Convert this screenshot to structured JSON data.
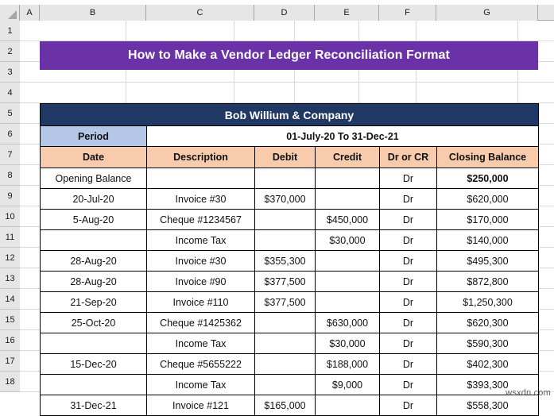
{
  "spreadsheet": {
    "column_headers": [
      "A",
      "B",
      "C",
      "D",
      "E",
      "F",
      "G"
    ],
    "row_numbers": [
      "1",
      "2",
      "3",
      "4",
      "5",
      "6",
      "7",
      "8",
      "9",
      "10",
      "11",
      "12",
      "13",
      "14",
      "15",
      "16",
      "17",
      "18"
    ]
  },
  "colors": {
    "banner_purple": "#6B32A8",
    "company_navy": "#1F3864",
    "period_blue": "#B4C7E7",
    "header_peach": "#F8CBAD",
    "grid_gray": "#D9D9D9",
    "header_strip": "#E6E6E6"
  },
  "banner": {
    "title": "How to Make a Vendor Ledger Reconciliation Format"
  },
  "ledger": {
    "company_name": "Bob Willium & Company",
    "period_label": "Period",
    "period_value": "01-July-20 To 31-Dec-21",
    "columns": [
      "Date",
      "Description",
      "Debit",
      "Credit",
      "Dr or CR",
      "Closing Balance"
    ],
    "rows": [
      {
        "date": "Opening Balance",
        "description": "",
        "debit": "",
        "credit": "",
        "drcr": "Dr",
        "balance": "$250,000",
        "balance_bold": true
      },
      {
        "date": "20-Jul-20",
        "description": "Invoice #30",
        "debit": "$370,000",
        "credit": "",
        "drcr": "Dr",
        "balance": "$620,000"
      },
      {
        "date": "5-Aug-20",
        "description": "Cheque #1234567",
        "debit": "",
        "credit": "$450,000",
        "drcr": "Dr",
        "balance": "$170,000"
      },
      {
        "date": "",
        "description": "Income Tax",
        "debit": "",
        "credit": "$30,000",
        "drcr": "Dr",
        "balance": "$140,000"
      },
      {
        "date": "28-Aug-20",
        "description": "Invoice #30",
        "debit": "$355,300",
        "credit": "",
        "drcr": "Dr",
        "balance": "$495,300"
      },
      {
        "date": "28-Aug-20",
        "description": "Invoice #90",
        "debit": "$377,500",
        "credit": "",
        "drcr": "Dr",
        "balance": "$872,800"
      },
      {
        "date": "21-Sep-20",
        "description": "Invoice #110",
        "debit": "$377,500",
        "credit": "",
        "drcr": "Dr",
        "balance": "$1,250,300"
      },
      {
        "date": "25-Oct-20",
        "description": "Cheque #1425362",
        "debit": "",
        "credit": "$630,000",
        "drcr": "Dr",
        "balance": "$620,300"
      },
      {
        "date": "",
        "description": "Income Tax",
        "debit": "",
        "credit": "$30,000",
        "drcr": "Dr",
        "balance": "$590,300"
      },
      {
        "date": "15-Dec-20",
        "description": "Cheque #5655222",
        "debit": "",
        "credit": "$188,000",
        "drcr": "Dr",
        "balance": "$402,300"
      },
      {
        "date": "",
        "description": "Income Tax",
        "debit": "",
        "credit": "$9,000",
        "drcr": "Dr",
        "balance": "$393,300"
      },
      {
        "date": "31-Dec-21",
        "description": "Invoice #121",
        "debit": "$165,000",
        "credit": "",
        "drcr": "Dr",
        "balance": "$558,300"
      }
    ]
  },
  "watermark": {
    "text": "wsxdn.com"
  }
}
